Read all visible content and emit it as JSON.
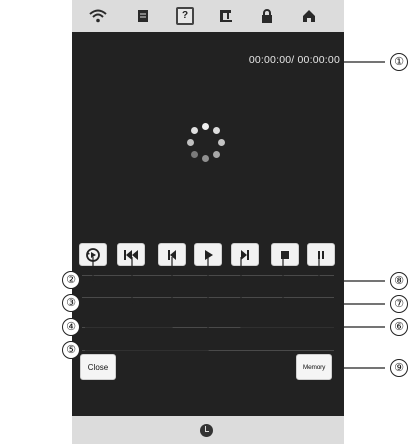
{
  "topbar": {
    "icons": [
      "wifi-icon",
      "document-icon",
      "help-icon",
      "machine-icon",
      "lock-icon",
      "home-icon"
    ],
    "help_label": "?"
  },
  "screen": {
    "time_display": "00:00:00/ 00:00:00",
    "controls": [
      "replay",
      "skip-to-start",
      "previous-chapter",
      "play",
      "next-chapter",
      "stop",
      "pause"
    ],
    "close_label": "Close",
    "memory_label": "Memory"
  },
  "bottombar": {
    "icon": "clock-icon"
  },
  "callouts": {
    "c1": "①",
    "c2": "②",
    "c3": "③",
    "c4": "④",
    "c5": "⑤",
    "c6": "⑥",
    "c7": "⑦",
    "c8": "⑧",
    "c9": "⑨"
  },
  "colors": {
    "screen_bg": "#222222",
    "bar_bg": "#dcdcdc",
    "button_bg": "#f2f2f2"
  }
}
